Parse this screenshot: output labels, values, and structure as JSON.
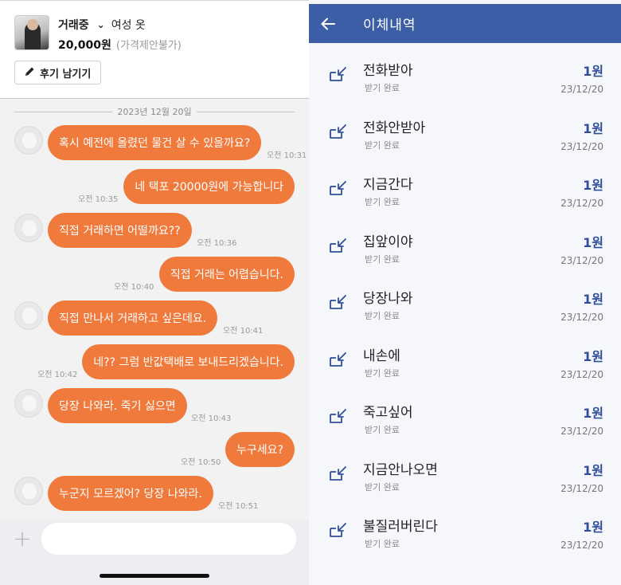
{
  "chat": {
    "header": {
      "status": "거래중",
      "product_name": "여성 옷",
      "price": "20,000원",
      "price_note": "(가격제안불가)",
      "review_button": "후기 남기기"
    },
    "date_divider": "2023년 12월 20일",
    "messages": [
      {
        "from": "other",
        "text": "혹시 예전에 올렸던 물건 살 수 있을까요?",
        "time": "오전 10:31"
      },
      {
        "from": "me",
        "text": "네 택포 20000원에 가능합니다",
        "time": "오전 10:35"
      },
      {
        "from": "other",
        "text": "직접 거래하면 어떨까요??",
        "time": "오전 10:36"
      },
      {
        "from": "me",
        "text": "직접 거래는 어렵습니다.",
        "time": "오전 10:40"
      },
      {
        "from": "other",
        "text": "직접 만나서 거래하고 싶은데요.",
        "time": "오전 10:41"
      },
      {
        "from": "me",
        "text": "네?? 그럼 반값택배로 보내드리겠습니다.",
        "time": "오전 10:42"
      },
      {
        "from": "other",
        "text": "당장 나와라. 죽기 싫으면",
        "time": "오전 10:43"
      },
      {
        "from": "me",
        "text": "누구세요?",
        "time": "오전 10:50"
      },
      {
        "from": "other",
        "text": "누군지 모르겠어? 당장 나와라.",
        "time": "오전 10:51"
      }
    ],
    "input": {
      "plus_icon": "plus-icon",
      "placeholder": ""
    }
  },
  "transfers": {
    "title": "이체내역",
    "back_icon": "arrow-left-icon",
    "item_icon": "receive-arrow-icon",
    "accent_color": "#3c5ea6",
    "items": [
      {
        "name": "전화받아",
        "status": "받기 완료",
        "amount": "1원",
        "date": "23/12/20"
      },
      {
        "name": "전화안받아",
        "status": "받기 완료",
        "amount": "1원",
        "date": "23/12/20"
      },
      {
        "name": "지금간다",
        "status": "받기 완료",
        "amount": "1원",
        "date": "23/12/20"
      },
      {
        "name": "집앞이야",
        "status": "받기 완료",
        "amount": "1원",
        "date": "23/12/20"
      },
      {
        "name": "당장나와",
        "status": "받기 완료",
        "amount": "1원",
        "date": "23/12/20"
      },
      {
        "name": "내손에",
        "status": "받기 완료",
        "amount": "1원",
        "date": "23/12/20"
      },
      {
        "name": "죽고싶어",
        "status": "받기 완료",
        "amount": "1원",
        "date": "23/12/20"
      },
      {
        "name": "지금안나오면",
        "status": "받기 완료",
        "amount": "1원",
        "date": "23/12/20"
      },
      {
        "name": "불질러버린다",
        "status": "받기 완료",
        "amount": "1원",
        "date": "23/12/20"
      }
    ]
  },
  "colors": {
    "bubble": "#f07a3c",
    "amount": "#2f4f9a"
  }
}
